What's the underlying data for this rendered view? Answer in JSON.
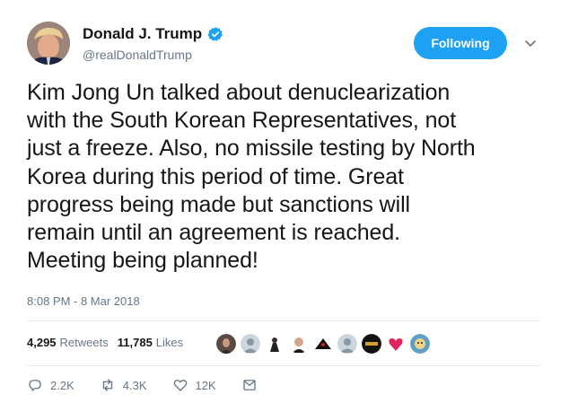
{
  "header": {
    "display_name": "Donald J. Trump",
    "handle": "@realDonaldTrump",
    "verified": true,
    "follow_button_label": "Following"
  },
  "tweet": {
    "lines": [
      "Kim Jong Un talked about denuclearization",
      "with the South Korean Representatives, not",
      "just a freeze. Also, no missile testing by North",
      "Korea during this period of time. Great",
      "progress being made but sanctions will",
      "remain until an agreement is reached.",
      "Meeting being planned!"
    ],
    "timestamp": "8:08 PM - 8 Mar 2018"
  },
  "stats": {
    "retweets_count": "4,295",
    "retweets_label": "Retweets",
    "likes_count": "11,785",
    "likes_label": "Likes"
  },
  "likers": [
    "liker-avatar-1",
    "liker-avatar-2",
    "liker-avatar-3",
    "liker-avatar-4",
    "liker-avatar-5",
    "liker-avatar-6",
    "liker-avatar-7",
    "liker-avatar-8",
    "liker-avatar-9"
  ],
  "actions": {
    "reply_count": "2.2K",
    "retweet_count": "4.3K",
    "like_count": "12K"
  },
  "colors": {
    "accent": "#1da1f2",
    "text": "#14171a",
    "muted": "#657786",
    "divider": "#e6ecf0"
  }
}
